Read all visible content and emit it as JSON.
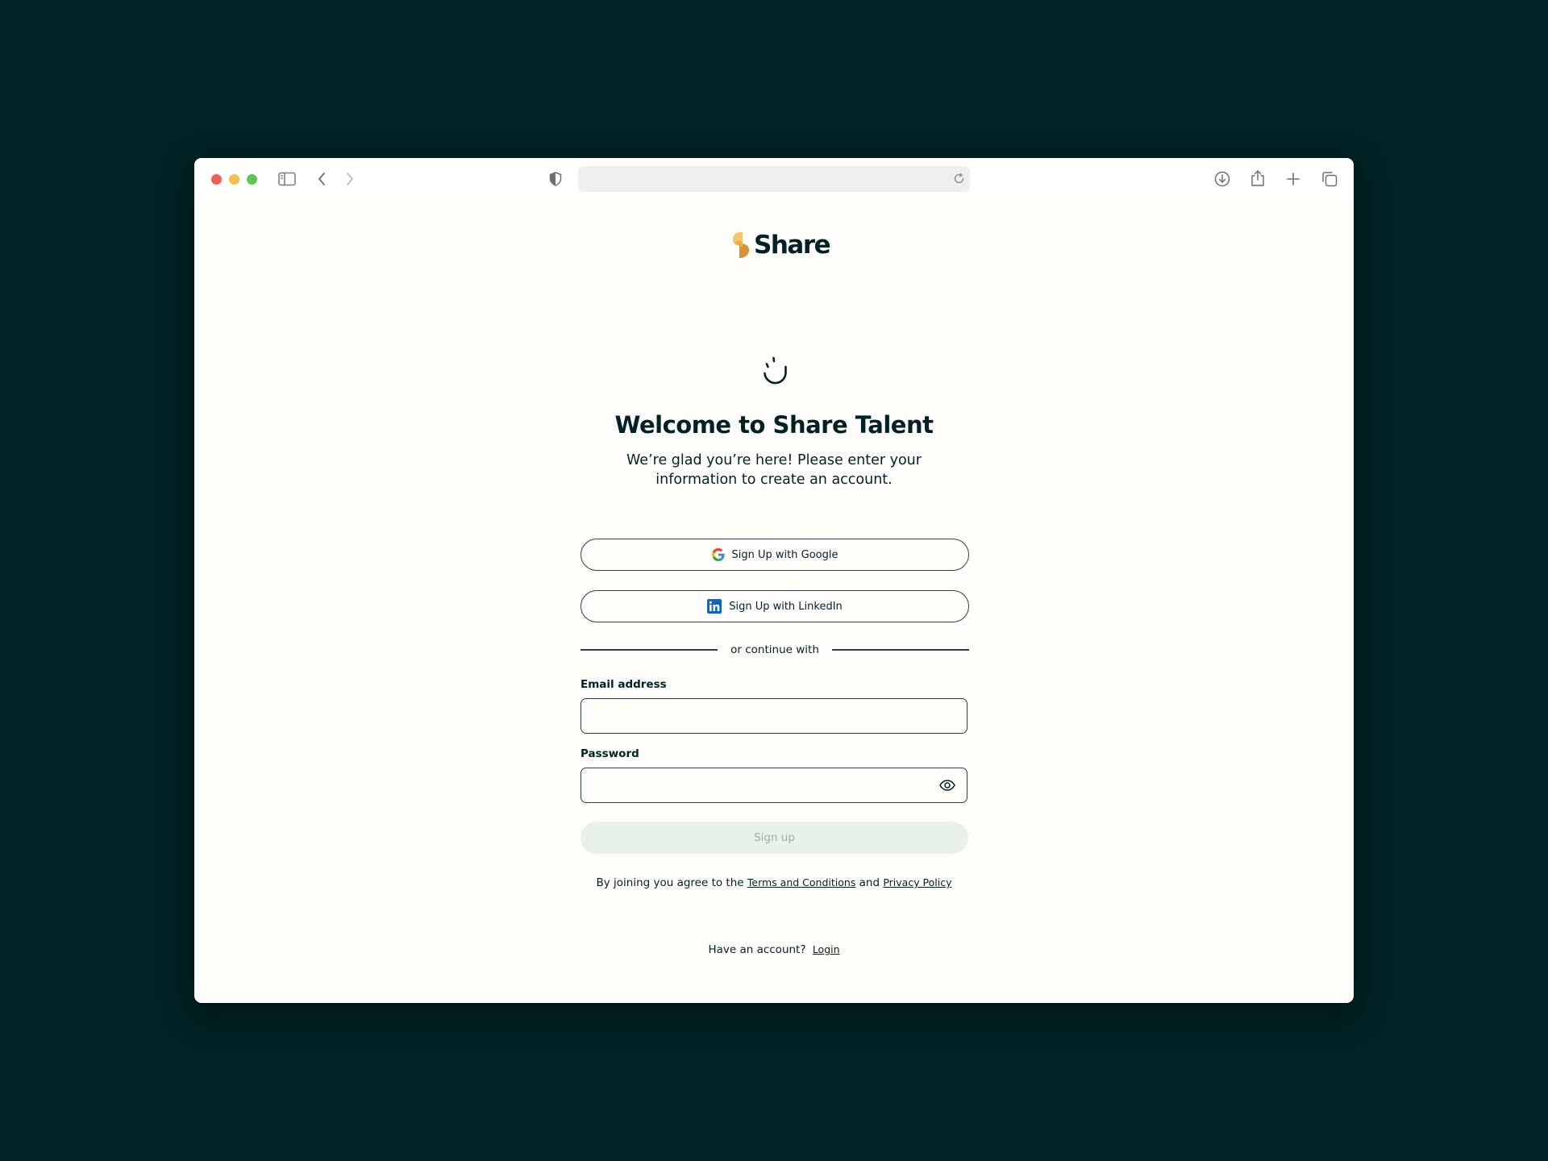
{
  "browser": {
    "url": "",
    "icons": [
      "sidebar-icon",
      "back-icon",
      "forward-icon",
      "shield-icon",
      "reload-icon",
      "download-icon",
      "share-icon",
      "new-tab-icon",
      "tabs-overview-icon"
    ]
  },
  "brand": {
    "name": "Share",
    "colors": {
      "dark": "#012224",
      "logo_gold": "#e8b04a",
      "logo_orange": "#d99a3a",
      "disabled_bg": "#e9f2ea",
      "disabled_text": "#8fb5a6"
    }
  },
  "page": {
    "title": "Welcome to Share Talent",
    "subtitle": "We’re glad you’re here! Please enter your information to create an account.",
    "google_button": "Sign Up with Google",
    "linkedin_button": "Sign Up with LinkedIn",
    "divider_text": "or continue with",
    "email_label": "Email address",
    "email_value": "",
    "password_label": "Password",
    "password_value": "",
    "signup_button": "Sign up",
    "terms_prefix": "By joining you agree to the",
    "terms_link": "Terms and Conditions",
    "terms_and": "and",
    "privacy_link": "Privacy Policy",
    "have_account": "Have an account?",
    "login_link": "Login"
  }
}
